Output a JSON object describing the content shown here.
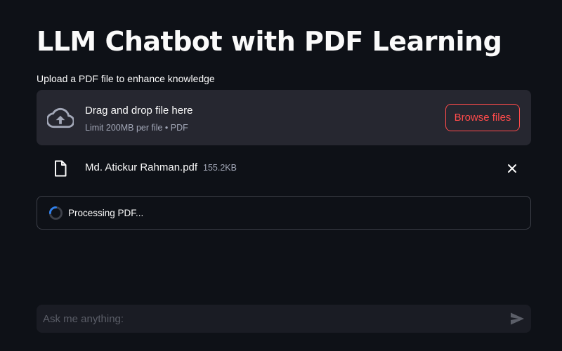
{
  "header": {
    "title": "LLM Chatbot with PDF Learning"
  },
  "uploader": {
    "label": "Upload a PDF file to enhance knowledge",
    "dropzone_title": "Drag and drop file here",
    "dropzone_limit": "Limit 200MB per file • PDF",
    "browse_label": "Browse files",
    "icon": "cloud-upload-icon"
  },
  "uploaded_file": {
    "name": "Md. Atickur Rahman.pdf",
    "size": "155.2KB",
    "icon": "file-icon",
    "remove_icon": "close-icon"
  },
  "status": {
    "text": "Processing PDF...",
    "icon": "spinner-icon"
  },
  "chat": {
    "placeholder": "Ask me anything:",
    "send_icon": "send-icon"
  },
  "colors": {
    "background": "#0e1117",
    "panel": "#262730",
    "accent": "#ff4b4b",
    "muted_text": "#a3a8b8",
    "spinner": "#2f80ed"
  }
}
